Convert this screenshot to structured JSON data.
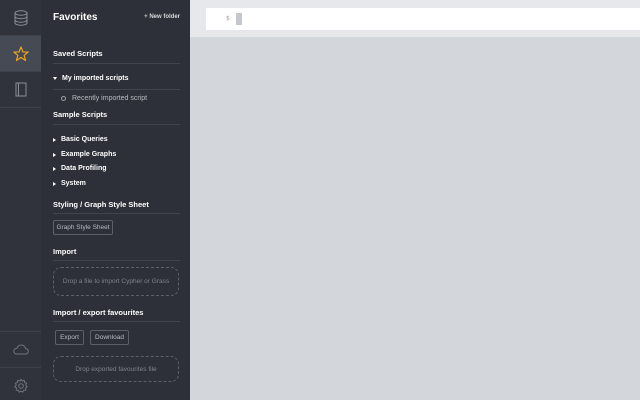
{
  "drawer": {
    "title": "Favorites",
    "new_folder": "+ New folder",
    "saved_scripts": "Saved Scripts",
    "my_imported_scripts": "My imported scripts",
    "recently_imported_script": "Recently imported script",
    "sample_scripts": "Sample Scripts",
    "sample_folders": [
      "Basic Queries",
      "Example Graphs",
      "Data Profiling",
      "System"
    ],
    "styling_title": "Styling / Graph Style Sheet",
    "graph_style_sheet_button": "Graph Style Sheet",
    "import_title": "Import",
    "import_dropzone": "Drop a file to import Cypher or Grass",
    "import_export_title": "Import / export favourites",
    "export_button": "Export",
    "download_button": "Download",
    "favourites_dropzone": "Drop exported favourites file"
  },
  "editor": {
    "prompt": "$"
  },
  "icons": {
    "rail": [
      "database-icon",
      "star-icon",
      "book-icon",
      "cloud-icon",
      "gear-icon"
    ],
    "accent": "#f5a623"
  }
}
